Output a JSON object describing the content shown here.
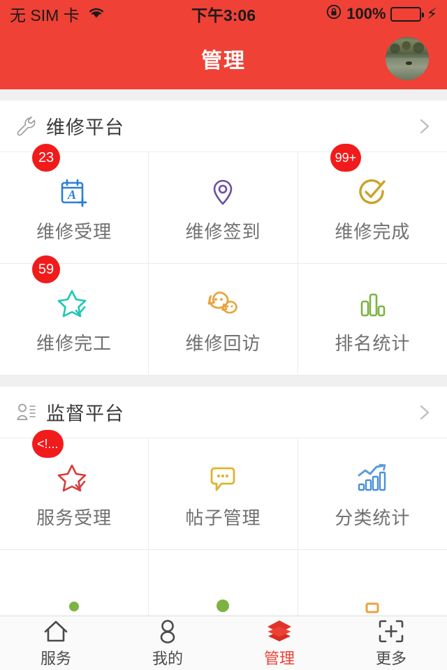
{
  "status_bar": {
    "carrier": "无 SIM 卡",
    "wifi_icon": "wifi-icon",
    "time": "下午3:06",
    "rotation_lock_icon": "rotation-lock-icon",
    "battery_percent": "100%",
    "battery_icon": "battery-icon",
    "charging_icon": "charging-bolt-icon",
    "bolt": "⚡",
    "battery_color": "#4cd964"
  },
  "nav": {
    "title": "管理",
    "avatar_name": "user-avatar",
    "background_color": "#ef4136"
  },
  "sections": [
    {
      "icon": "wrench-icon",
      "title": "维修平台",
      "chevron": "chevron-right-icon",
      "items": [
        {
          "label": "维修受理",
          "icon": "note-a-plus-icon",
          "badge": "23",
          "color": "#2b7fd4"
        },
        {
          "label": "维修签到",
          "icon": "location-pin-icon",
          "badge": "",
          "color": "#6b4fa0"
        },
        {
          "label": "维修完成",
          "icon": "check-circle-icon",
          "badge": "99+",
          "color": "#c9a32a"
        },
        {
          "label": "维修完工",
          "icon": "star-check-icon",
          "badge": "59",
          "color": "#1ec8b4"
        },
        {
          "label": "维修回访",
          "icon": "chat-bubbles-icon",
          "badge": "",
          "color": "#e8a33d"
        },
        {
          "label": "排名统计",
          "icon": "bar-chart-icon",
          "badge": "",
          "color": "#7cb342"
        }
      ]
    },
    {
      "icon": "person-list-icon",
      "title": "监督平台",
      "chevron": "chevron-right-icon",
      "items": [
        {
          "label": "服务受理",
          "icon": "star-check-icon",
          "badge": "<!...",
          "color": "#d93b3b"
        },
        {
          "label": "帖子管理",
          "icon": "chat-bubble-dots-icon",
          "badge": "",
          "color": "#dcb52c"
        },
        {
          "label": "分类统计",
          "icon": "trend-bar-chart-icon",
          "badge": "",
          "color": "#4a90d9"
        },
        {
          "label": "",
          "icon": "partial-green-icon",
          "badge": "",
          "color": "#7cb342"
        },
        {
          "label": "",
          "icon": "partial-green2-icon",
          "badge": "",
          "color": "#7cb342"
        },
        {
          "label": "",
          "icon": "partial-orange-icon",
          "badge": "",
          "color": "#e8a33d"
        }
      ]
    }
  ],
  "tabbar": {
    "items": [
      {
        "label": "服务",
        "icon": "home-icon",
        "active": false
      },
      {
        "label": "我的",
        "icon": "person-icon",
        "active": false
      },
      {
        "label": "管理",
        "icon": "layers-icon",
        "active": true
      },
      {
        "label": "更多",
        "icon": "plus-frame-icon",
        "active": false
      }
    ],
    "active_color": "#ef4136"
  }
}
